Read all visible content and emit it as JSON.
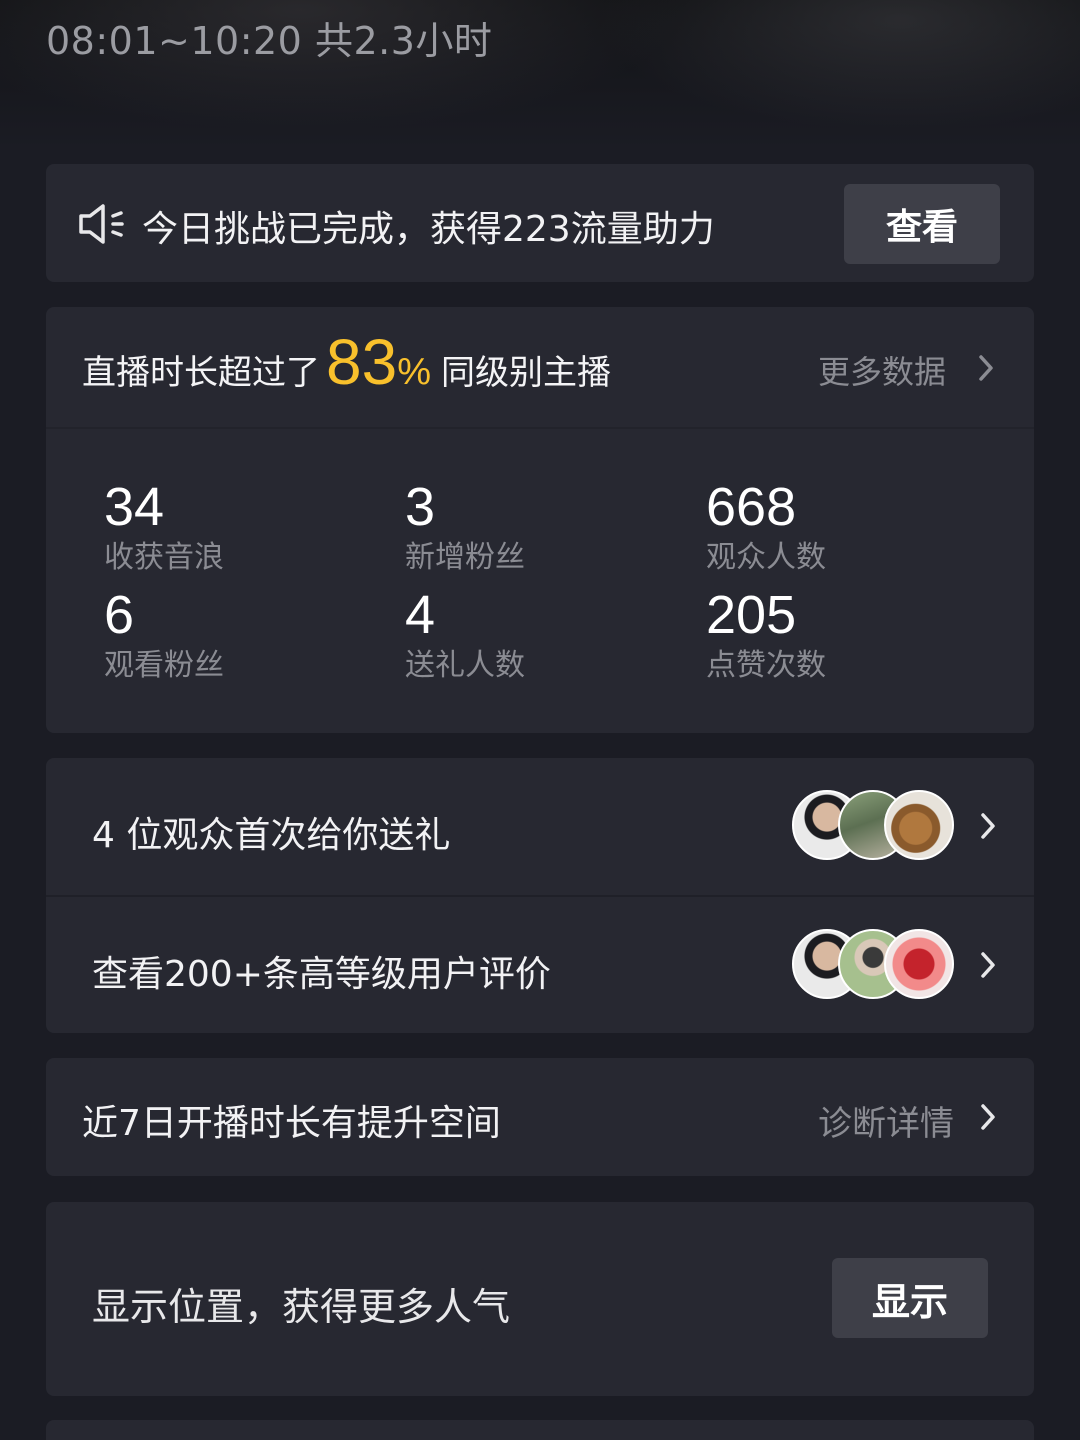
{
  "session": {
    "time_range": "08:01~10:20 共2.3小时"
  },
  "challenge": {
    "text": "今日挑战已完成，获得223流量助力",
    "button_label": "查看",
    "icon": "speaker-icon"
  },
  "summary": {
    "prefix": "直播时长超过了",
    "percent_value": "83",
    "percent_symbol": "%",
    "suffix": "同级别主播",
    "more_label": "更多数据",
    "accent_color": "#f8c02c"
  },
  "stats": [
    {
      "value": "34",
      "label": "收获音浪"
    },
    {
      "value": "3",
      "label": "新增粉丝"
    },
    {
      "value": "668",
      "label": "观众人数"
    },
    {
      "value": "6",
      "label": "观看粉丝"
    },
    {
      "value": "4",
      "label": "送礼人数"
    },
    {
      "value": "205",
      "label": "点赞次数"
    }
  ],
  "lists": [
    {
      "text": "4 位观众首次给你送礼"
    },
    {
      "text": "查看200+条高等级用户评价"
    }
  ],
  "diagnosis": {
    "text": "近7日开播时长有提升空间",
    "link_label": "诊断详情"
  },
  "location": {
    "text": "显示位置，获得更多人气",
    "button_label": "显示"
  }
}
